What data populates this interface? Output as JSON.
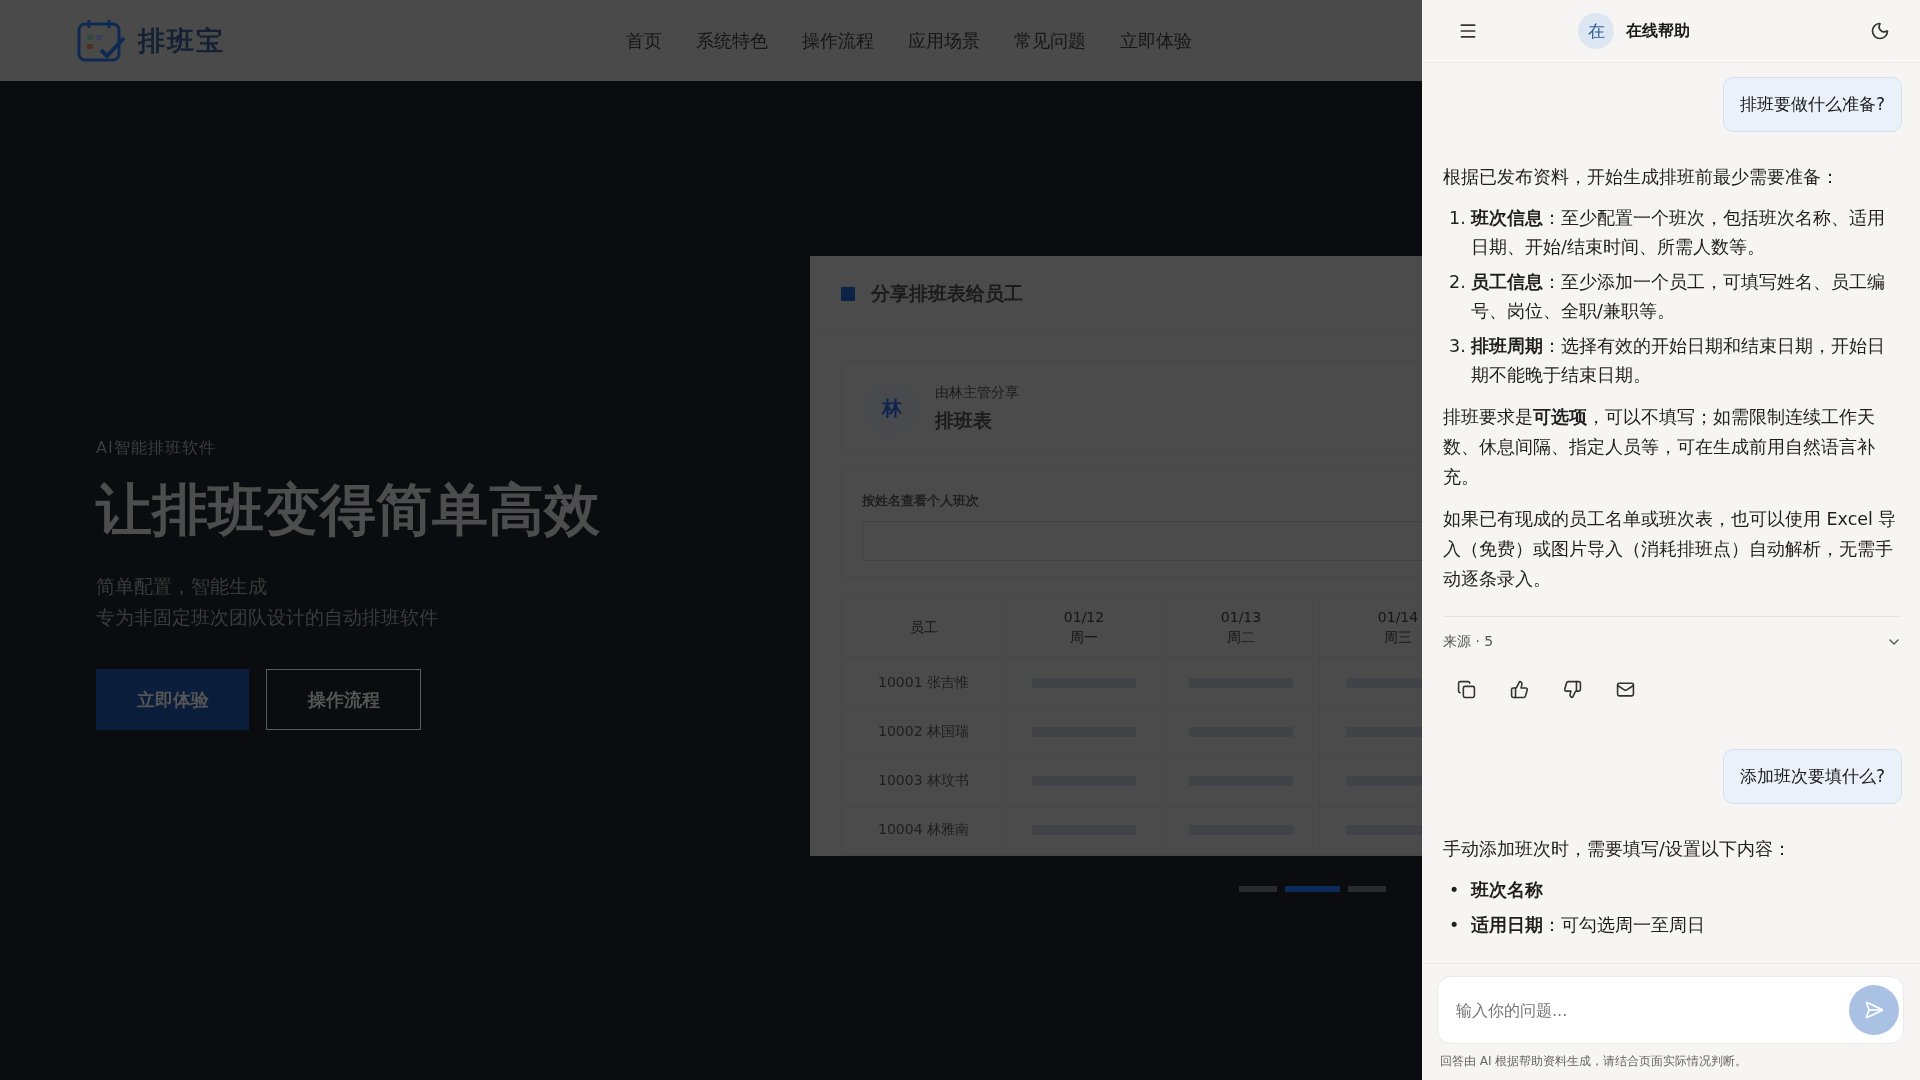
{
  "header": {
    "logo_text": "排班宝",
    "nav": [
      {
        "label": "首页"
      },
      {
        "label": "系统特色"
      },
      {
        "label": "操作流程"
      },
      {
        "label": "应用场景"
      },
      {
        "label": "常见问题"
      },
      {
        "label": "立即体验"
      }
    ]
  },
  "hero": {
    "eyebrow": "AI智能排班软件",
    "title": "让排班变得简单高效",
    "subtitle_lines": [
      "简单配置，智能生成",
      "专为非固定班次团队设计的自动排班软件"
    ],
    "buttons": [
      {
        "label": "立即体验",
        "kind": "primary"
      },
      {
        "label": "操作流程",
        "kind": "outline"
      }
    ]
  },
  "card": {
    "title": "分享排班表给员工",
    "share": {
      "avatar": "林",
      "by": "由林主管分享",
      "name": "排班表"
    },
    "search": {
      "label": "按姓名查看个人班次"
    },
    "table": {
      "first_column": "员工",
      "columns": [
        {
          "date": "01/12",
          "weekday": "周一"
        },
        {
          "date": "01/13",
          "weekday": "周二"
        },
        {
          "date": "01/14",
          "weekday": "周三"
        }
      ],
      "rows": [
        {
          "employee": "10001 张吉惟"
        },
        {
          "employee": "10002 林国瑞"
        },
        {
          "employee": "10003 林玟书"
        },
        {
          "employee": "10004 林雅南"
        }
      ]
    }
  },
  "carousel": [
    {
      "selected": false
    },
    {
      "selected": true
    },
    {
      "selected": false
    }
  ],
  "chat": {
    "avatar": "在",
    "title": "在线帮助",
    "messages": [
      {
        "kind": "user",
        "text": "排班要做什么准备?"
      },
      {
        "kind": "answer",
        "blocks": [
          {
            "kind": "paragraph",
            "text": "根据已发布资料，开始生成排班前最少需要准备："
          },
          {
            "kind": "list",
            "items": [
              {
                "marker": "1.",
                "text": "**班次信息**：至少配置一个班次，包括班次名称、适用日期、开始/结束时间、所需人数等。"
              },
              {
                "marker": "2.",
                "text": "**员工信息**：至少添加一个员工，可填写姓名、员工编号、岗位、全职/兼职等。"
              },
              {
                "marker": "3.",
                "text": "**排班周期**：选择有效的开始日期和结束日期，开始日期不能晚于结束日期。"
              }
            ]
          },
          {
            "kind": "paragraph",
            "text": "排班要求是**可选项**，可以不填写；如需限制连续工作天数、休息间隔、指定人员等，可在生成前用自然语言补充。"
          },
          {
            "kind": "paragraph",
            "text": "如果已有现成的员工名单或班次表，也可以使用 Excel 导入（免费）或图片导入（消耗排班点）自动解析，无需手动逐条录入。"
          }
        ],
        "sources": "来源 · 5"
      },
      {
        "kind": "user",
        "text": "添加班次要填什么?"
      },
      {
        "kind": "answer",
        "blocks": [
          {
            "kind": "paragraph",
            "text": "手动添加班次时，需要填写/设置以下内容："
          },
          {
            "kind": "list",
            "items": [
              {
                "marker": "•",
                "text": "**班次名称**"
              },
              {
                "marker": "•",
                "text": "**适用日期**：可勾选周一至周日"
              }
            ]
          }
        ]
      }
    ],
    "input": {
      "placeholder": "输入你的问题..."
    },
    "disclaimer": "回答由 AI 根据帮助资料生成，请结合页面实际情况判断。"
  }
}
